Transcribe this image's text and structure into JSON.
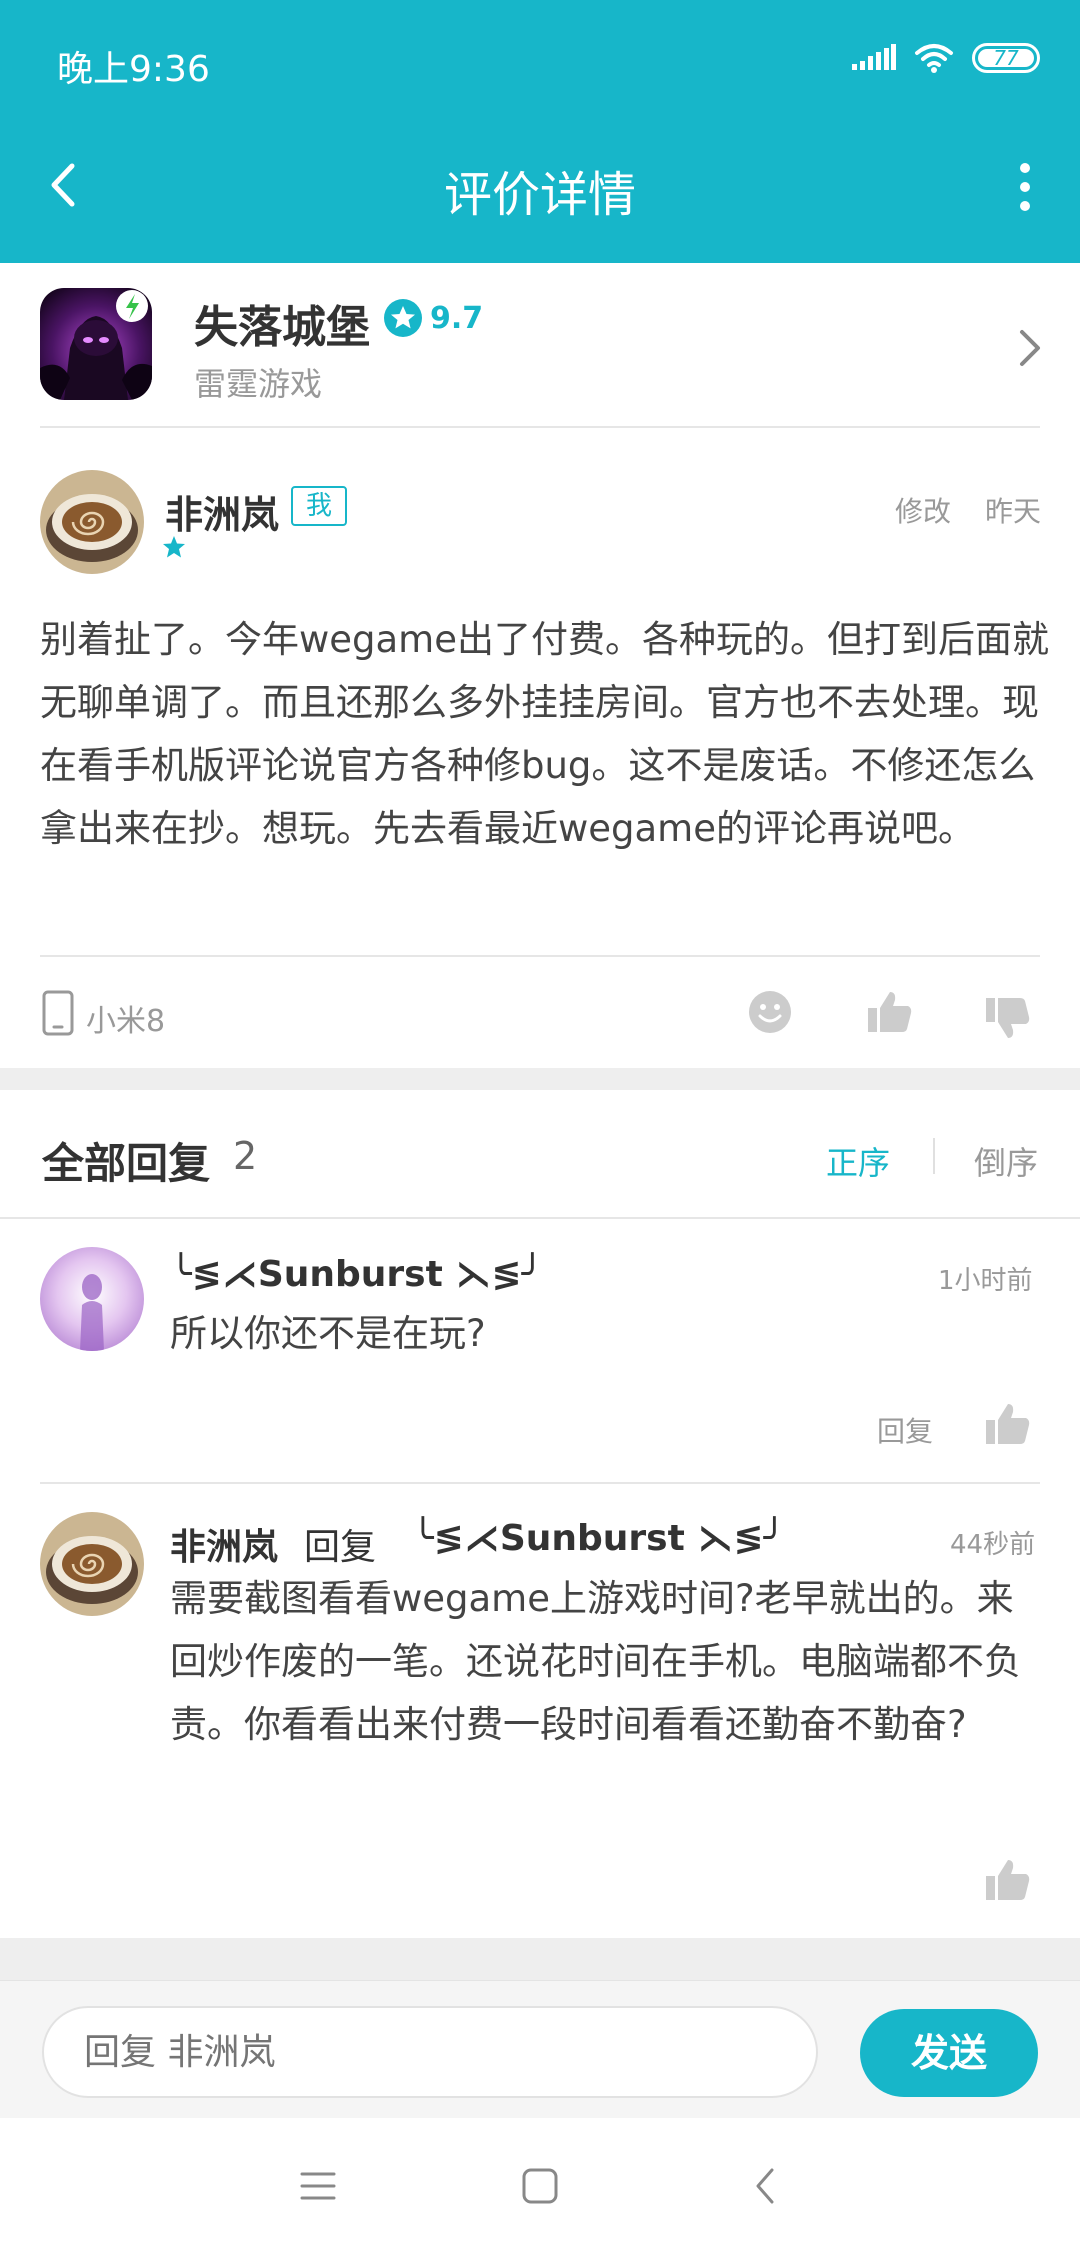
{
  "status_bar": {
    "time": "晚上9:36",
    "battery": "77"
  },
  "header": {
    "title": "评价详情"
  },
  "game": {
    "name": "失落城堡",
    "rating": "9.7",
    "developer": "雷霆游戏"
  },
  "review": {
    "author": "非洲岚",
    "badge": "我",
    "stars": 1,
    "edit_label": "修改",
    "date": "昨天",
    "body": "别着扯了。今年wegame出了付费。各种玩的。但打到后面就无聊单调了。而且还那么多外挂挂房间。官方也不去处理。现在看手机版评论说官方各种修bug。这不是废话。不修还怎么拿出来在抄。想玩。先去看最近wegame的评论再说吧。",
    "device": "小米8"
  },
  "replies_section": {
    "title": "全部回复",
    "count": "2",
    "sort_asc": "正序",
    "sort_desc": "倒序"
  },
  "replies": [
    {
      "author": "╰≶⋌Sunburst ⋋≶╯",
      "time": "1小时前",
      "text": "所以你还不是在玩?",
      "reply_label": "回复"
    },
    {
      "author": "非洲岚",
      "reply_to_label": "回复",
      "reply_to": "╰≶⋌Sunburst ⋋≶╯",
      "time": "44秒前",
      "text": "需要截图看看wegame上游戏时间?老早就出的。来回炒作废的一笔。还说花时间在手机。电脑端都不负责。你看看出来付费一段时间看看还勤奋不勤奋?"
    }
  ],
  "input": {
    "placeholder": "回复 非洲岚",
    "send_label": "发送"
  },
  "colors": {
    "accent": "#17b6c9",
    "text": "#333333",
    "muted": "#999999"
  },
  "icons": [
    "back-arrow-icon",
    "more-vert-icon",
    "star-icon",
    "chevron-right-icon",
    "phone-icon",
    "emoji-icon",
    "thumb-up-icon",
    "thumb-down-icon",
    "menu-icon",
    "home-icon",
    "nav-back-icon"
  ]
}
